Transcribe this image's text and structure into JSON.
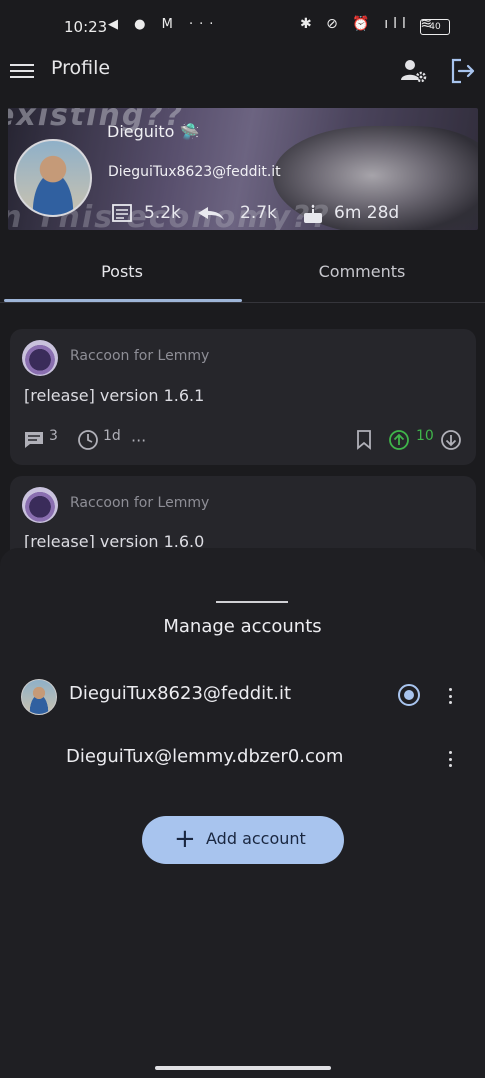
{
  "status_bar": {
    "time": "10:23",
    "left_icons": "◀ ● M ···",
    "right_icons": "✱ ⊘ ⏰ ıll ≋",
    "battery": "40"
  },
  "app_bar": {
    "title": "Profile",
    "menu_icon": "hamburger-menu-icon",
    "manage_icon": "manage-accounts-icon",
    "logout_icon": "logout-icon"
  },
  "profile": {
    "banner_text_top": "existing??",
    "banner_text_bottom": "in This economy??",
    "name": "Dieguito 🛸",
    "handle": "DieguiTux8623@feddit.it",
    "stats": {
      "posts": "5.2k",
      "comments": "2.7k",
      "age": "6m 28d"
    }
  },
  "tabs": [
    {
      "label": "Posts",
      "active": true
    },
    {
      "label": "Comments",
      "active": false
    }
  ],
  "posts": [
    {
      "community": "Raccoon for Lemmy",
      "title": "[release] version 1.6.1",
      "comments": "3",
      "time": "1d",
      "upvotes": "10"
    },
    {
      "community": "Raccoon for Lemmy",
      "title": "[release] version 1.6.0"
    }
  ],
  "sheet": {
    "title": "Manage accounts",
    "accounts": [
      {
        "name": "DieguiTux8623@feddit.it",
        "selected": true
      },
      {
        "name": "DieguiTux@lemmy.dbzer0.com",
        "selected": false
      }
    ],
    "add_button": "Add account"
  },
  "colors": {
    "background": "#1b1b1e",
    "accent": "#a8c4ee",
    "upvote": "#3fb54a"
  }
}
